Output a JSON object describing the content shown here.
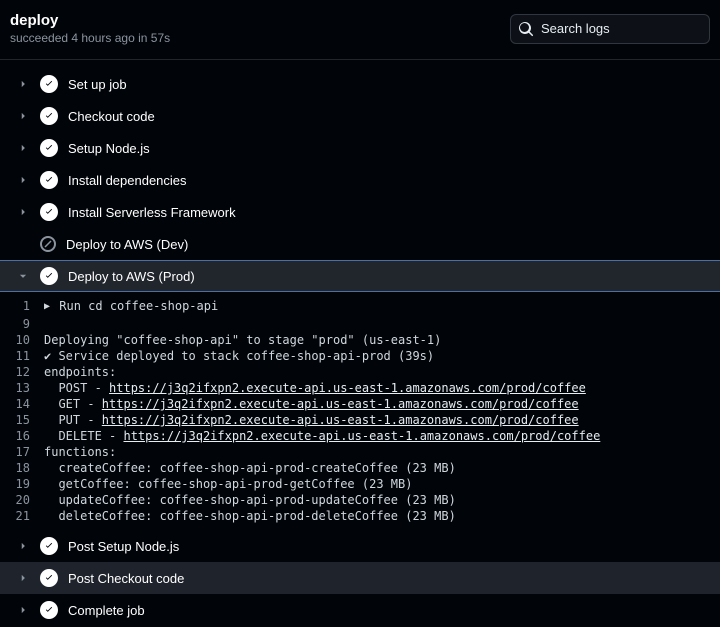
{
  "header": {
    "title": "deploy",
    "subtitle": "succeeded 4 hours ago in 57s",
    "search_placeholder": "Search logs"
  },
  "steps": [
    {
      "label": "Set up job",
      "status": "success",
      "expanded": false,
      "chevron": true
    },
    {
      "label": "Checkout code",
      "status": "success",
      "expanded": false,
      "chevron": true
    },
    {
      "label": "Setup Node.js",
      "status": "success",
      "expanded": false,
      "chevron": true
    },
    {
      "label": "Install dependencies",
      "status": "success",
      "expanded": false,
      "chevron": true
    },
    {
      "label": "Install Serverless Framework",
      "status": "success",
      "expanded": false,
      "chevron": true
    },
    {
      "label": "Deploy to AWS (Dev)",
      "status": "skipped",
      "expanded": false,
      "chevron": false
    },
    {
      "label": "Deploy to AWS (Prod)",
      "status": "success",
      "expanded": true,
      "chevron": true
    },
    {
      "label": "Post Setup Node.js",
      "status": "success",
      "expanded": false,
      "chevron": true
    },
    {
      "label": "Post Checkout code",
      "status": "success",
      "expanded": false,
      "chevron": true,
      "highlight": true
    },
    {
      "label": "Complete job",
      "status": "success",
      "expanded": false,
      "chevron": true
    }
  ],
  "log": {
    "prefix_run": "▸ Run ",
    "run_cmd": "cd coffee-shop-api",
    "check": "✔ ",
    "url_base": "https://j3q2ifxpn2.execute-api.us-east-1.amazonaws.com/prod/coffee",
    "lines": {
      "l10": "Deploying \"coffee-shop-api\" to stage \"prod\" (us-east-1)",
      "l11": "Service deployed to stack coffee-shop-api-prod (39s)",
      "l12": "endpoints:",
      "l13a": "  POST - ",
      "l14a": "  GET - ",
      "l15a": "  PUT - ",
      "l16a": "  DELETE - ",
      "l17": "functions:",
      "l18": "  createCoffee: coffee-shop-api-prod-createCoffee (23 MB)",
      "l19": "  getCoffee: coffee-shop-api-prod-getCoffee (23 MB)",
      "l20": "  updateCoffee: coffee-shop-api-prod-updateCoffee (23 MB)",
      "l21": "  deleteCoffee: coffee-shop-api-prod-deleteCoffee (23 MB)"
    },
    "numbers": [
      "1",
      "9",
      "10",
      "11",
      "12",
      "13",
      "14",
      "15",
      "16",
      "17",
      "18",
      "19",
      "20",
      "21"
    ]
  }
}
